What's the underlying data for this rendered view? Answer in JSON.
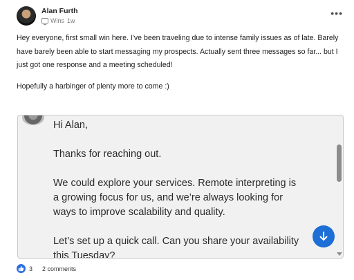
{
  "post": {
    "author": "Alan Furth",
    "category": "Wins",
    "time": "1w",
    "more_icon": "more-dots-icon",
    "body": [
      "Hey everyone, first small win here. I've been traveling due to intense family issues as of late. Barely have barely been able to start messaging my prospects. Actually sent three messages so far... but I just got one response and a meeting scheduled!",
      "Hopefully a harbinger of plenty more to come :)"
    ]
  },
  "attachment": {
    "greeting": "Hi Alan,",
    "line1": "Thanks for reaching out.",
    "line2": "We could explore your services. Remote interpreting is a growing focus for us, and we’re always looking for ways to improve scalability and quality.",
    "line3": "Let’s set up a quick call. Can you share your availability this Tuesday?",
    "scroll_icon": "arrow-down-icon"
  },
  "footer": {
    "likes": "3",
    "comments": "2 comments",
    "like_icon": "thumbs-up-icon"
  },
  "colors": {
    "accent": "#1d6fd6",
    "like": "#2f6de1"
  }
}
